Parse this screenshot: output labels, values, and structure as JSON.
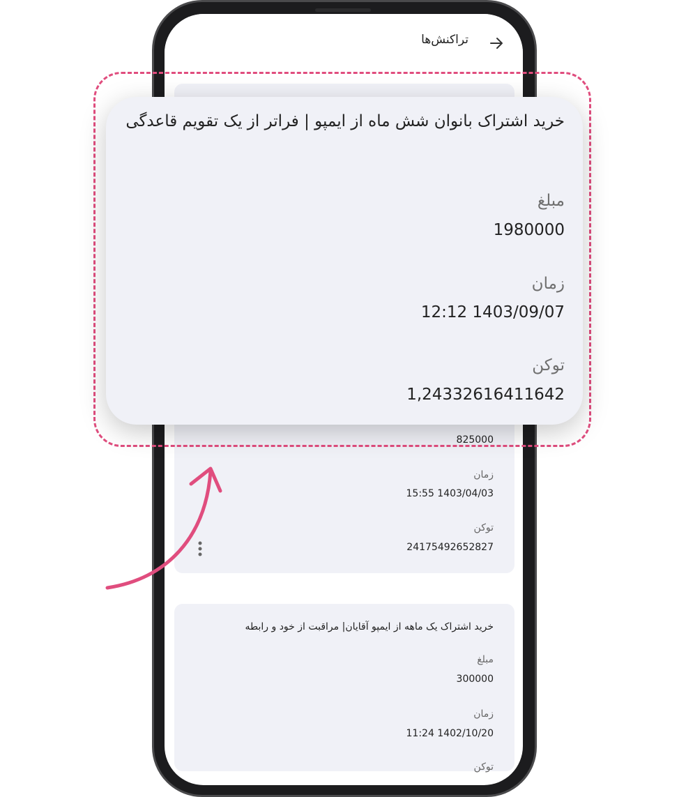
{
  "header": {
    "title": "تراکنش‌ها"
  },
  "zoom_card": {
    "title": "خرید اشتراک بانوان شش ماه از ایمپو | فراتر از یک تقویم قاعدگی",
    "amount_label": "مبلغ",
    "amount_value": "1980000",
    "time_label": "زمان",
    "time_value": "12:12 1403/09/07",
    "token_label": "توکن",
    "token_value": "1,24332616411642"
  },
  "card_1": {
    "amount_value": "825000",
    "time_label": "زمان",
    "time_value": "15:55 1403/04/03",
    "token_label": "توکن",
    "token_value": "24175492652827"
  },
  "card_2": {
    "title": "خرید اشتراک یک ماهه از ایمپو آقایان| مراقبت از خود و رابطه",
    "amount_label": "مبلغ",
    "amount_value": "300000",
    "time_label": "زمان",
    "time_value": "11:24 1402/10/20",
    "token_label": "توکن"
  },
  "colors": {
    "accent": "#e04d7e",
    "card_bg": "#f0f1f7",
    "frame": "#1c1c1e"
  },
  "icons": [
    "back-arrow-icon",
    "more-vertical-icon",
    "curved-arrow-icon"
  ]
}
